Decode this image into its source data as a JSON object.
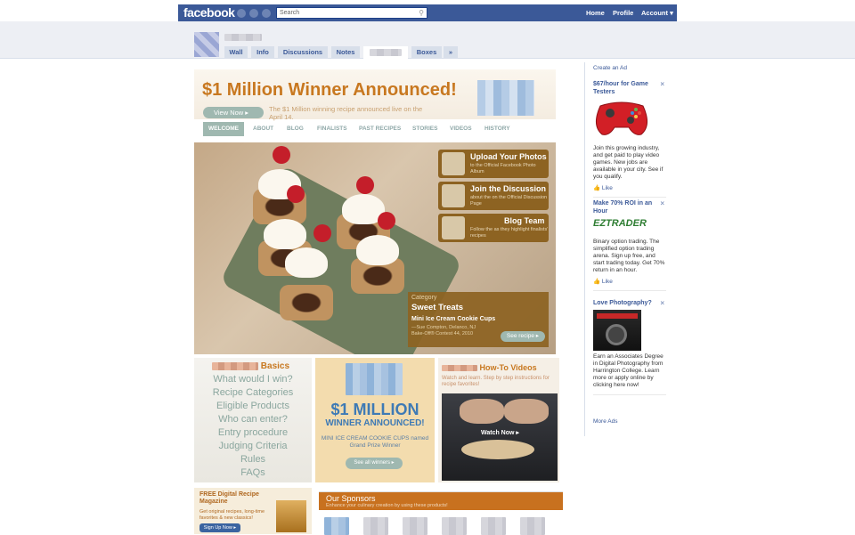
{
  "facebook": {
    "logo": "facebook",
    "search_placeholder": "Search",
    "nav": [
      "Home",
      "Profile",
      "Account ▾"
    ]
  },
  "profile": {
    "tabs": [
      "Wall",
      "Info",
      "Discussions",
      "Notes",
      "",
      "Boxes",
      "»"
    ]
  },
  "hero": {
    "headline": "$1 Million Winner Announced!",
    "view_button": "View Now  ▸",
    "subtext": "The $1 Million winning recipe announced live on the                     April 14."
  },
  "menu": [
    "WELCOME",
    "ABOUT",
    "BLOG",
    "FINALISTS",
    "PAST RECIPES",
    "STORIES",
    "VIDEOS",
    "HISTORY"
  ],
  "feature": {
    "buttons": [
      {
        "title": "Upload Your Photos",
        "sub": "to the Official                Facebook Photo Album"
      },
      {
        "title": "Join the Discussion",
        "sub": "about the                on the Official Discussion Page"
      },
      {
        "title": "Blog Team",
        "sub": "Follow the                as they highlight finalists' recipes"
      }
    ],
    "category_label": "Category",
    "category": "Sweet Treats",
    "recipe": "Mini Ice Cream Cookie Cups",
    "author": "—Sue Compton, Delanco, NJ",
    "contest": "Bake-Off® Contest 44, 2010",
    "see_recipe": "See recipe ▸"
  },
  "basics": {
    "heading": "Basics",
    "items": [
      "What would I win?",
      "Recipe Categories",
      "Eligible Products",
      "Who can enter?",
      "Entry procedure",
      "Judging Criteria",
      "Rules",
      "FAQs"
    ]
  },
  "million": {
    "big": "$1 MILLION",
    "big2": "WINNER ANNOUNCED!",
    "mini": "MINI ICE CREAM COOKIE CUPS named Grand Prize Winner",
    "button": "See all winners ▸"
  },
  "howto": {
    "heading": "How-To Videos",
    "sub": "Watch and learn. Step by step instructions for recipe favorites!",
    "watch": "Watch Now ▸"
  },
  "magazine": {
    "title": "FREE              Digital Recipe Magazine",
    "sub": "Get original recipes, long-time favorites & new classics!",
    "button": "Sign Up Now ▸"
  },
  "sponsors": {
    "title": "Our Sponsors",
    "sub": "Enhance your culinary creation by using these products!"
  },
  "ads": {
    "create": "Create an Ad",
    "items": [
      {
        "title": "$67/hour for Game Testers",
        "body": "Join this growing industry, and get paid to play video games. New jobs are available in your city. See if you qualify.",
        "like": "Like",
        "image": "controller"
      },
      {
        "title": "Make 70% ROI in an Hour",
        "body": "Binary option trading. The simplified option trading arena. Sign up free, and start trading today. Get 70% return in an hour.",
        "like": "Like",
        "image": "eztrader",
        "brand": "EZTRADER"
      },
      {
        "title": "Love Photography?",
        "body": "Earn an Associates Degree in Digital Photography from Harrington College. Learn more or apply online by clicking here now!",
        "like": "Like",
        "image": "camera"
      }
    ],
    "more": "More Ads"
  }
}
